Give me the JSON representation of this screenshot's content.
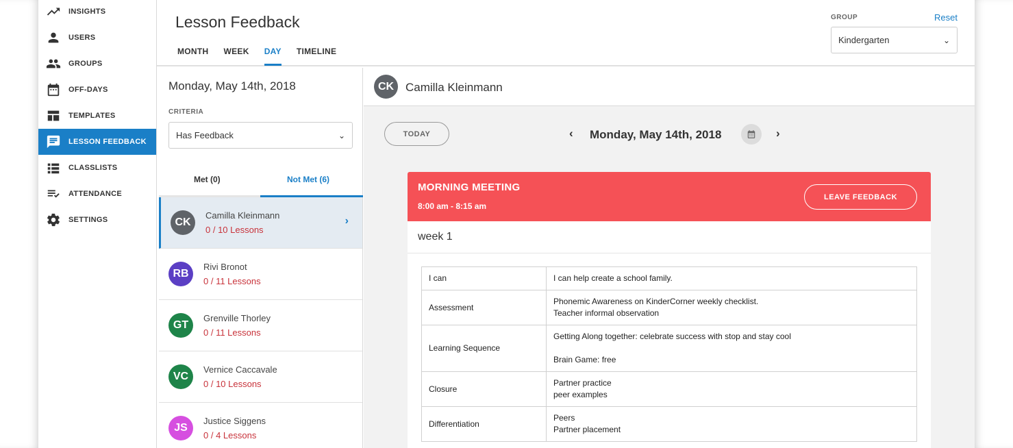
{
  "sidebar": {
    "items": [
      {
        "label": "INSIGHTS",
        "icon": "trending-up-icon",
        "active": false
      },
      {
        "label": "USERS",
        "icon": "person-icon",
        "active": false
      },
      {
        "label": "GROUPS",
        "icon": "group-icon",
        "active": false
      },
      {
        "label": "OFF-DAYS",
        "icon": "calendar-icon",
        "active": false
      },
      {
        "label": "TEMPLATES",
        "icon": "templates-icon",
        "active": false
      },
      {
        "label": "LESSON FEEDBACK",
        "icon": "feedback-icon",
        "active": true
      },
      {
        "label": "CLASSLISTS",
        "icon": "list-icon",
        "active": false
      },
      {
        "label": "ATTENDANCE",
        "icon": "checklist-icon",
        "active": false
      },
      {
        "label": "SETTINGS",
        "icon": "gear-icon",
        "active": false
      }
    ]
  },
  "header": {
    "title": "Lesson Feedback",
    "tabs": [
      {
        "label": "MONTH",
        "active": false
      },
      {
        "label": "WEEK",
        "active": false
      },
      {
        "label": "DAY",
        "active": true
      },
      {
        "label": "TIMELINE",
        "active": false
      }
    ],
    "group_label": "GROUP",
    "reset_label": "Reset",
    "group_value": "Kindergarten"
  },
  "list": {
    "date": "Monday, May 14th, 2018",
    "criteria_label": "CRITERIA",
    "criteria_value": "Has Feedback",
    "met_label": "Met (0)",
    "not_met_label": "Not Met (6)",
    "students": [
      {
        "initials": "CK",
        "name": "Camilla Kleinmann",
        "lessons": "0 / 10 Lessons",
        "color": "#5f6368",
        "selected": true
      },
      {
        "initials": "RB",
        "name": "Rivi Bronot",
        "lessons": "0 / 11 Lessons",
        "color": "#5b3fc4",
        "selected": false
      },
      {
        "initials": "GT",
        "name": "Grenville Thorley",
        "lessons": "0 / 11 Lessons",
        "color": "#1e8449",
        "selected": false
      },
      {
        "initials": "VC",
        "name": "Vernice Caccavale",
        "lessons": "0 / 10 Lessons",
        "color": "#1e8449",
        "selected": false
      },
      {
        "initials": "JS",
        "name": "Justice Siggens",
        "lessons": "0 / 4 Lessons",
        "color": "#d64fe0",
        "selected": false
      }
    ]
  },
  "detail": {
    "initials": "CK",
    "name": "Camilla Kleinmann",
    "today_label": "TODAY",
    "date": "Monday, May 14th, 2018",
    "lesson": {
      "title": "MORNING MEETING",
      "time": "8:00 am - 8:15 am",
      "feedback_label": "LEAVE FEEDBACK",
      "color": "#f55156",
      "week": "week 1",
      "rows": [
        {
          "key": "I can",
          "lines": [
            "I can help create a school family."
          ]
        },
        {
          "key": "Assessment",
          "lines": [
            "Phonemic Awareness on KinderCorner weekly checklist.",
            "Teacher informal observation"
          ]
        },
        {
          "key": "Learning Sequence",
          "lines": [
            "Getting Along together: celebrate success with stop and stay cool",
            "",
            "Brain Game: free"
          ]
        },
        {
          "key": "Closure",
          "lines": [
            "Partner practice",
            "peer examples"
          ]
        },
        {
          "key": "Differentiation",
          "lines": [
            "Peers",
            "Partner placement"
          ]
        }
      ]
    }
  }
}
